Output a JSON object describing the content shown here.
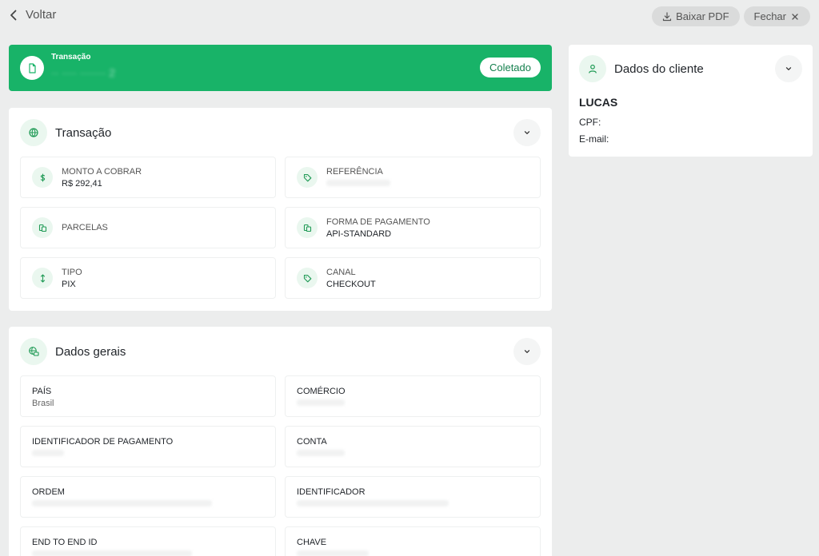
{
  "topbar": {
    "back_label": "Voltar",
    "download_label": "Baixar PDF",
    "close_label": "Fechar"
  },
  "transaction_banner": {
    "label": "Transação",
    "id_masked": "·· ····  ······· 2",
    "status": "Coletado",
    "color": "#18b368"
  },
  "transaction_card": {
    "title": "Transação",
    "fields": [
      {
        "label": "MONTO A COBRAR",
        "value": "R$ 292,41",
        "icon": "dollar-icon"
      },
      {
        "label": "REFERÊNCIA",
        "value": "",
        "icon": "tag-icon"
      },
      {
        "label": "PARCELAS",
        "value": "",
        "icon": "cards-icon"
      },
      {
        "label": "FORMA DE PAGAMENTO",
        "value": "API-STANDARD",
        "icon": "cards-icon"
      },
      {
        "label": "TIPO",
        "value": "PIX",
        "icon": "pix-icon"
      },
      {
        "label": "CANAL",
        "value": "CHECKOUT",
        "icon": "tag-icon"
      }
    ]
  },
  "general_card": {
    "title": "Dados gerais",
    "fields": [
      {
        "label": "PAÍS",
        "value": "Brasil"
      },
      {
        "label": "COMÉRCIO",
        "value": ""
      },
      {
        "label": "IDENTIFICADOR DE PAGAMENTO",
        "value": ""
      },
      {
        "label": "CONTA",
        "value": ""
      },
      {
        "label": "ORDEM",
        "value": ""
      },
      {
        "label": "IDENTIFICADOR",
        "value": ""
      },
      {
        "label": "END TO END ID",
        "value": ""
      },
      {
        "label": "CHAVE",
        "value": ""
      }
    ]
  },
  "client_card": {
    "title": "Dados do cliente",
    "name": "LUCAS",
    "cpf_label": "CPF:",
    "email_label": "E-mail:"
  },
  "colors": {
    "accent": "#18b368",
    "icon_bg": "#eaf7ef",
    "icon_fg": "#1f9a55",
    "background": "#eceded"
  }
}
